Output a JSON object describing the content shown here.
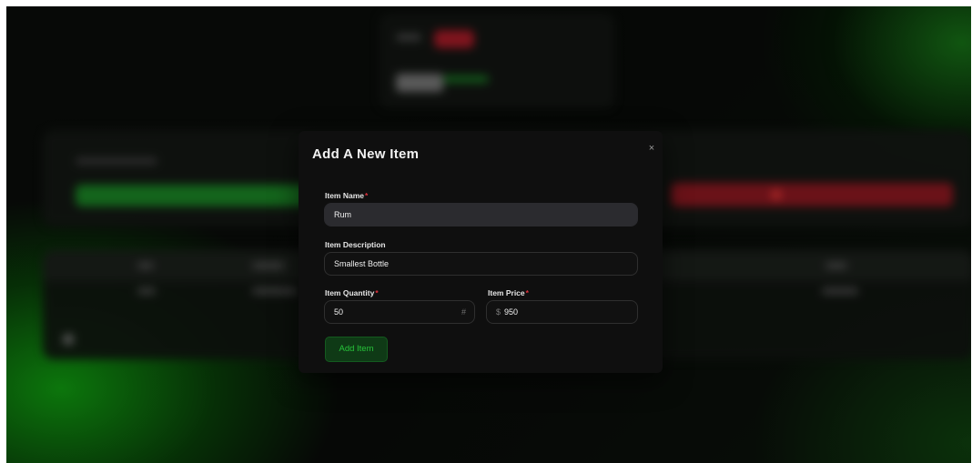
{
  "modal": {
    "title": "Add A New Item",
    "close_icon": "×",
    "fields": {
      "name": {
        "label": "Item Name",
        "required": "*",
        "value": "Rum"
      },
      "description": {
        "label": "Item Description",
        "value": "Smallest Bottle"
      },
      "quantity": {
        "label": "Item Quantity",
        "required": "*",
        "value": "50",
        "suffix": "#"
      },
      "price": {
        "label": "Item Price",
        "required": "*",
        "prefix": "$",
        "value": "950"
      }
    },
    "submit_label": "Add Item"
  },
  "colors": {
    "accent_green": "#27c43a",
    "required_red": "#e0313c",
    "modal_bg": "#0f0f0f"
  }
}
